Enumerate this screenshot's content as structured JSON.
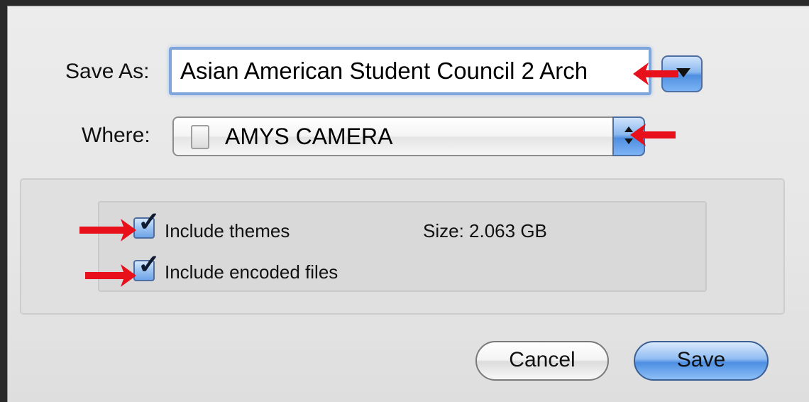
{
  "dialog": {
    "save_as_label": "Save As:",
    "save_as_value": "Asian American Student Council 2 Arch",
    "where_label": "Where:",
    "where_value": "AMYS CAMERA",
    "where_icon": "disk-icon"
  },
  "options": {
    "include_themes_label": "Include themes",
    "include_themes_checked": true,
    "include_encoded_label": "Include encoded files",
    "include_encoded_checked": true,
    "size_text": "Size: 2.063 GB"
  },
  "buttons": {
    "cancel_label": "Cancel",
    "save_label": "Save"
  },
  "colors": {
    "annotation_arrow": "#e8101a",
    "accent_blue": "#5a97e6"
  },
  "glyphs": {
    "check": "✓"
  }
}
